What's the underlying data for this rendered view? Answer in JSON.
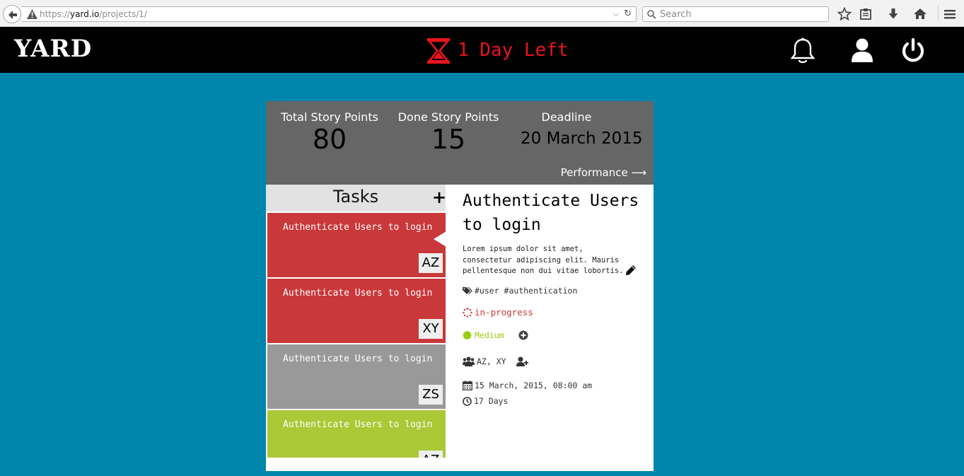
{
  "browser": {
    "url_scheme": "https://",
    "url_host": "yard.io",
    "url_path": "/projects/1/",
    "search_placeholder": "Search"
  },
  "header": {
    "logo": "YARD",
    "countdown": "1 Day Left",
    "countdown_color": "#e8141c"
  },
  "stats": {
    "total_label": "Total Story Points",
    "total_value": "80",
    "done_label": "Done Story Points",
    "done_value": "15",
    "deadline_label": "Deadline",
    "deadline_value": "20 March 2015",
    "performance_link": "Performance ⟶"
  },
  "tasks": {
    "title": "Tasks",
    "add_label": "+",
    "items": [
      {
        "title": "Authenticate Users to login",
        "assignee": "AZ",
        "color": "#c9383a",
        "selected": true
      },
      {
        "title": "Authenticate Users to login",
        "assignee": "XY",
        "color": "#c9383a"
      },
      {
        "title": "Authenticate Users to login",
        "assignee": "ZS",
        "color": "#999999"
      },
      {
        "title": "Authenticate Users to login",
        "assignee": "AZ",
        "color": "#abc837"
      }
    ]
  },
  "detail": {
    "title": "Authenticate Users to login",
    "description": "Lorem ipsum dolor sit amet, consectetur adipiscing elit. Mauris pellentesque non dui vitae lobortis.",
    "tags": "#user #authentication",
    "status": "in-progress",
    "status_color": "#c9383a",
    "priority": "Medium",
    "priority_color": "#9acd12",
    "assignees": "AZ, XY",
    "start_date": "15 March, 2015, 08:00 am",
    "duration": "17 Days"
  },
  "colors": {
    "background": "#0086ad",
    "header": "#000000",
    "stats_panel": "#666666"
  }
}
